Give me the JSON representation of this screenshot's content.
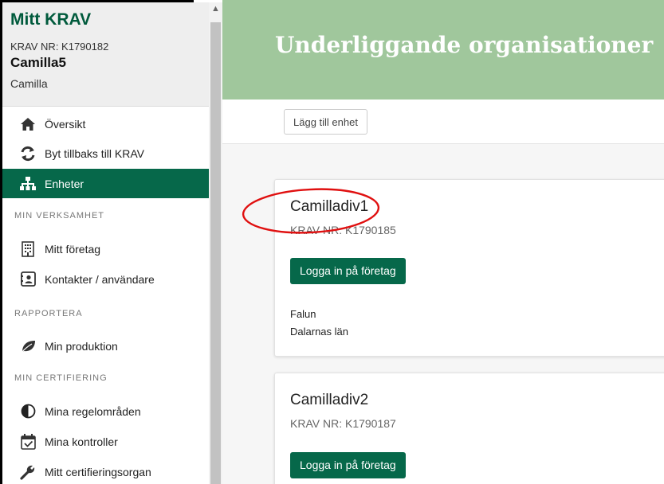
{
  "sidebar": {
    "brand": "Mitt KRAV",
    "krav_nr": "KRAV NR: K1790182",
    "user": "Camilla5",
    "username": "Camilla",
    "items": [
      {
        "label": "Översikt",
        "icon": "home-icon"
      },
      {
        "label": "Byt tillbaks till KRAV",
        "icon": "refresh-icon"
      },
      {
        "label": "Enheter",
        "icon": "sitemap-icon",
        "active": true
      }
    ],
    "sections": {
      "business": "MIN VERKSAMHET",
      "report": "RAPPORTERA",
      "certification": "MIN CERTIFIERING"
    },
    "business_items": [
      {
        "label": "Mitt företag",
        "icon": "building-icon"
      },
      {
        "label": "Kontakter / användare",
        "icon": "contact-card-icon"
      }
    ],
    "report_items": [
      {
        "label": "Min produktion",
        "icon": "leaf-icon"
      }
    ],
    "cert_items": [
      {
        "label": "Mina regelområden",
        "icon": "half-circle-icon"
      },
      {
        "label": "Mina kontroller",
        "icon": "calendar-check-icon"
      },
      {
        "label": "Mitt certifieringsorgan",
        "icon": "wrench-icon"
      }
    ]
  },
  "main": {
    "title": "Underliggande organisationer",
    "add_button": "Lägg till enhet",
    "cards": [
      {
        "name": "Camilladiv1",
        "krav_nr": "KRAV NR: K1790185",
        "login_label": "Logga in på företag",
        "city": "Falun",
        "county": "Dalarnas län"
      },
      {
        "name": "Camilladiv2",
        "krav_nr": "KRAV NR: K1790187",
        "login_label": "Logga in på företag"
      }
    ]
  },
  "colors": {
    "brand_green": "#005a3c",
    "active_green": "#06684a",
    "banner_green": "#a0c79c",
    "annotation_red": "#e01010"
  }
}
